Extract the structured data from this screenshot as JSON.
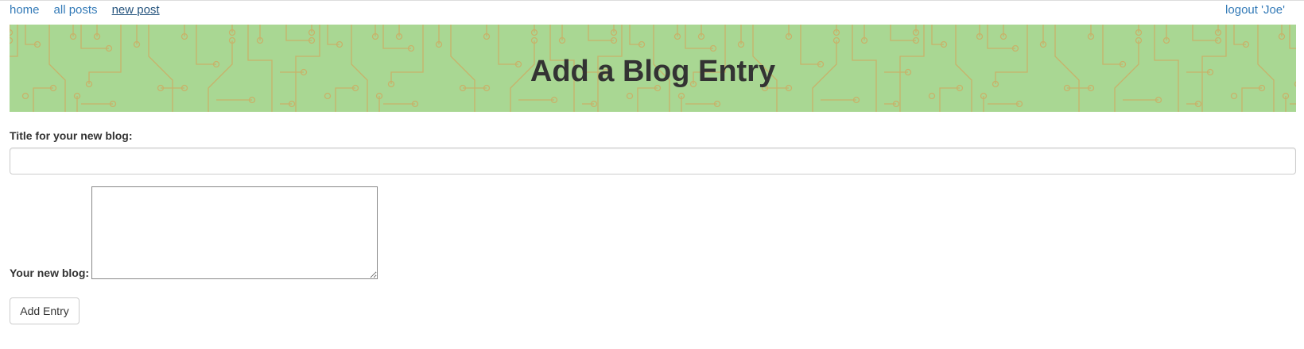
{
  "nav": {
    "links": [
      {
        "label": "home"
      },
      {
        "label": "all posts"
      },
      {
        "label": "new post"
      }
    ],
    "logout_label": "logout 'Joe'"
  },
  "banner": {
    "title": "Add a Blog Entry"
  },
  "form": {
    "title_label": "Title for your new blog:",
    "title_value": "",
    "blog_label": "Your new blog:",
    "blog_value": "",
    "submit_label": "Add Entry"
  },
  "colors": {
    "link": "#337ab7",
    "banner_bg": "#a9d793",
    "circuit": "#c8b26a",
    "text": "#333333"
  }
}
